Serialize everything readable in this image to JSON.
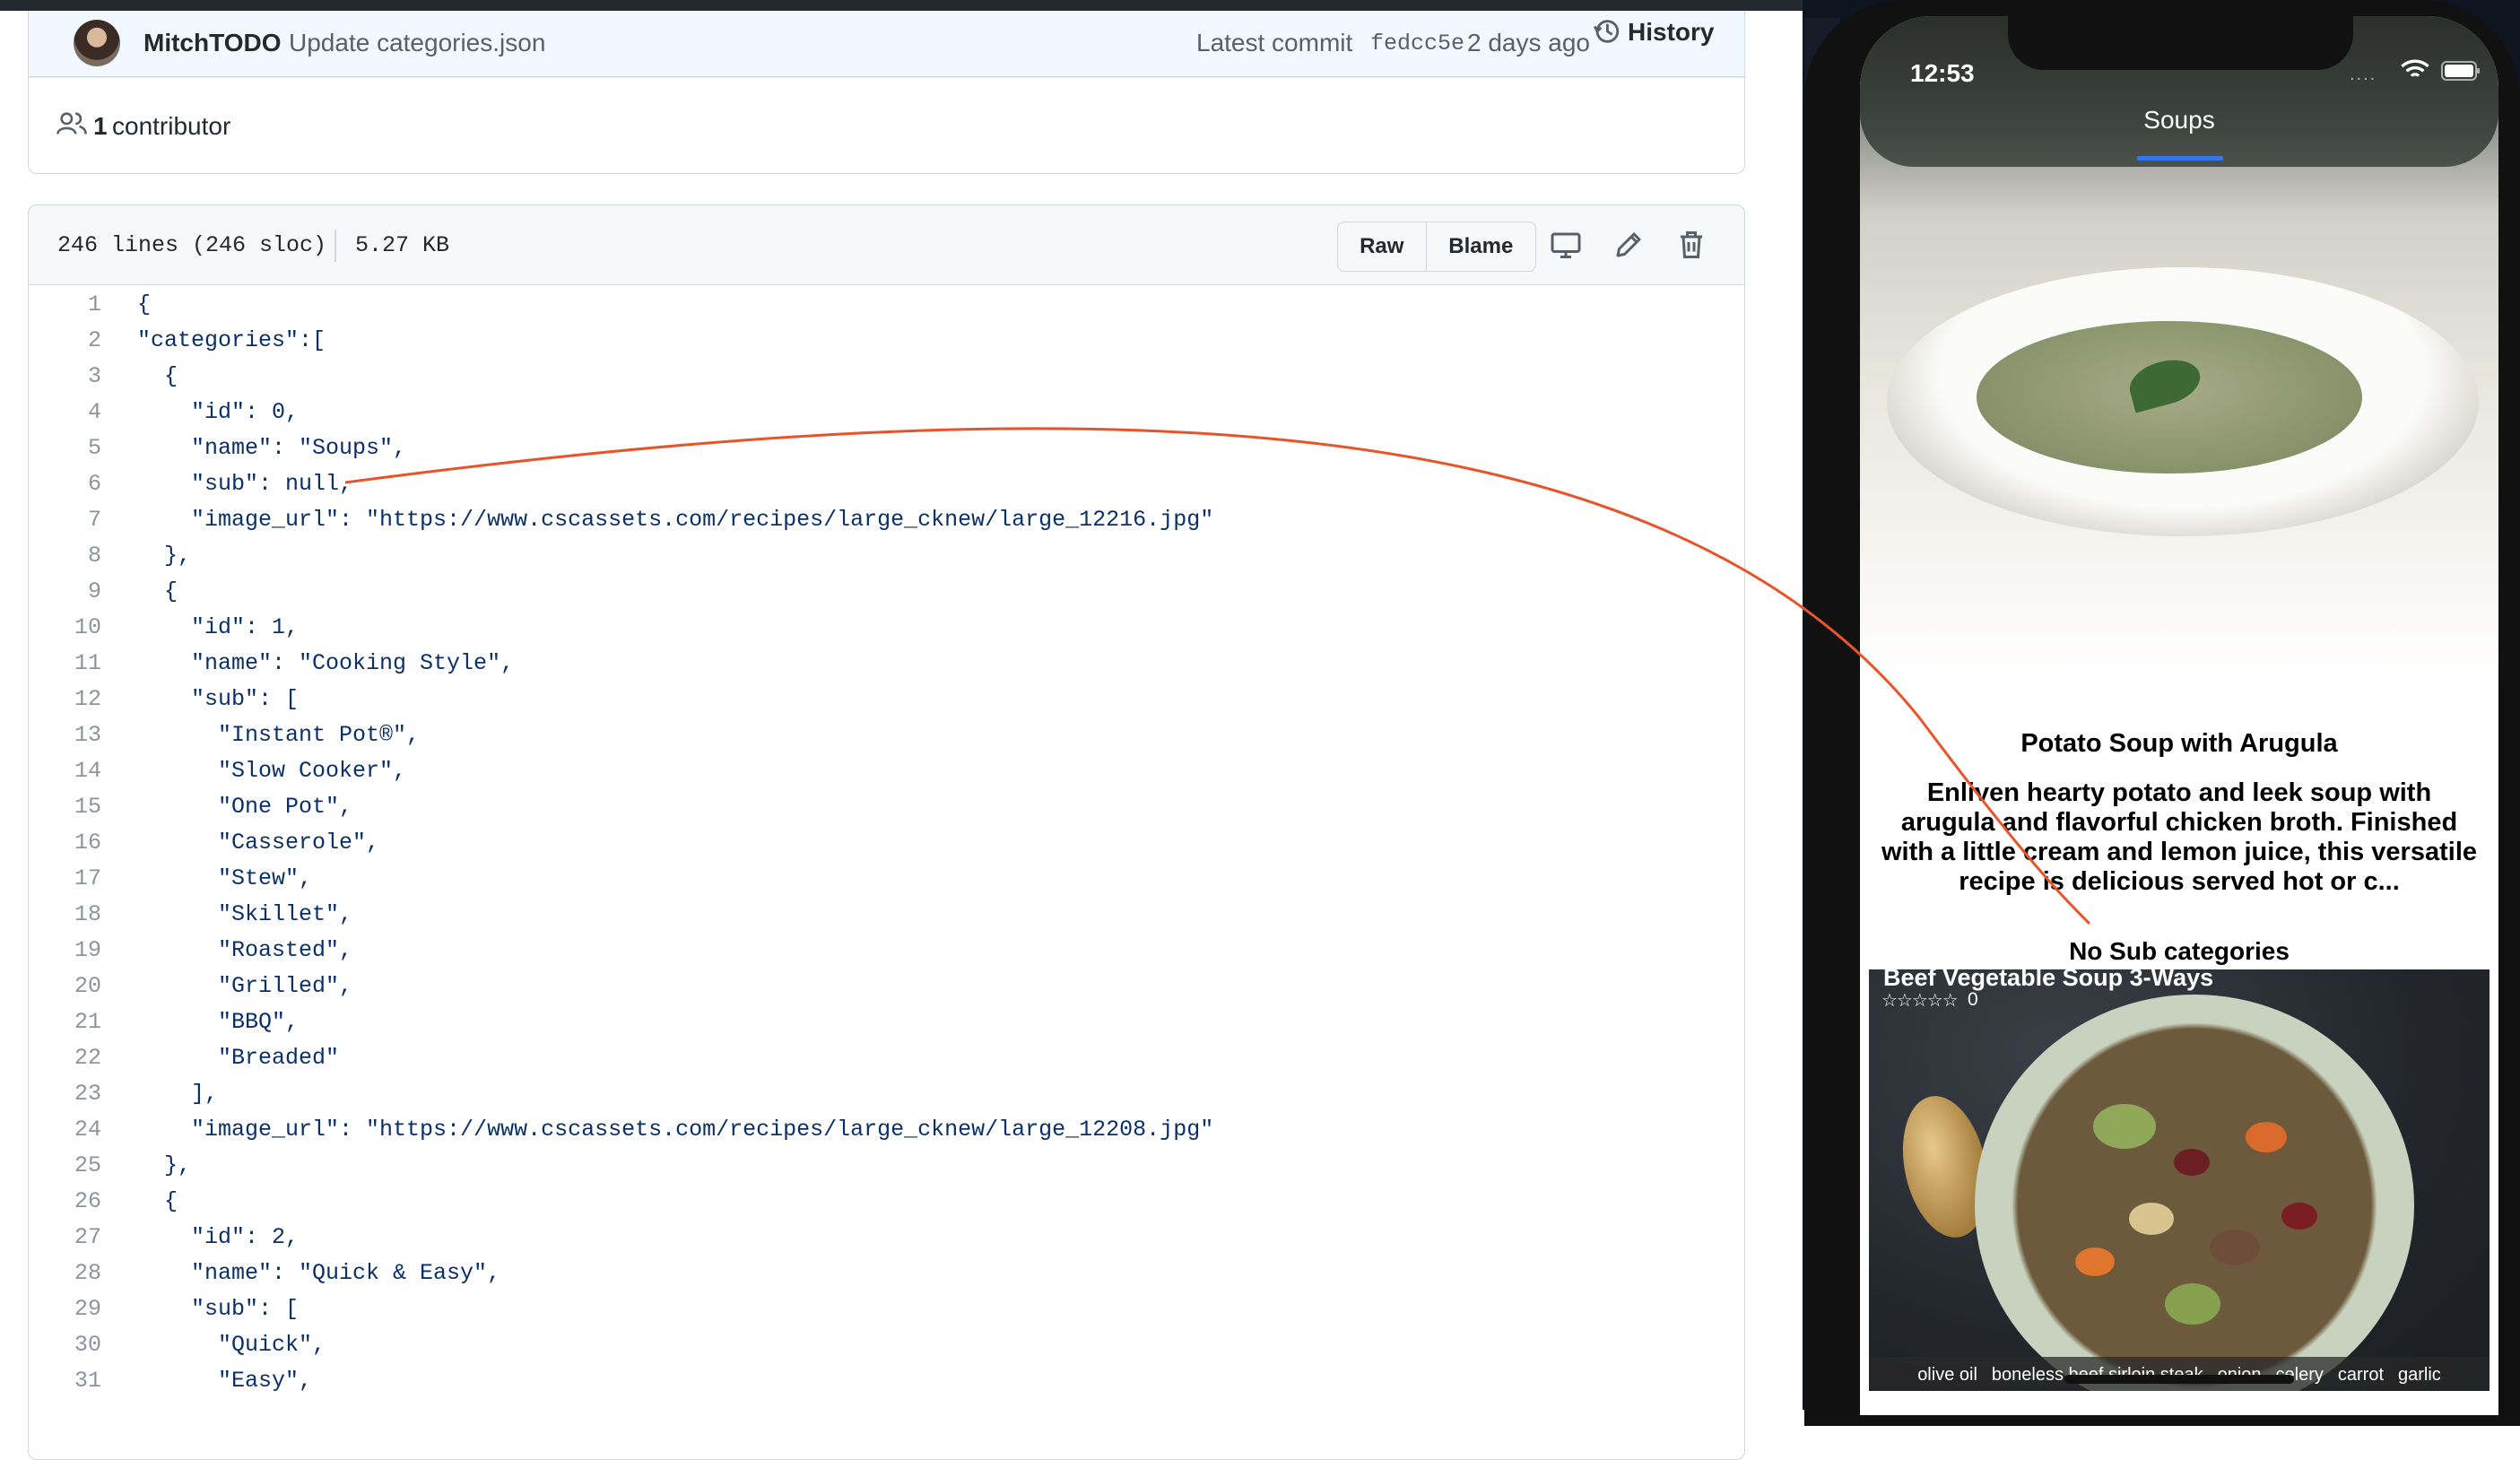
{
  "commit": {
    "author": "MitchTODO",
    "message": "Update categories.json",
    "latest_label": "Latest commit",
    "hash": "fedcc5e",
    "age": "2 days ago",
    "history_label": "History"
  },
  "contributors": {
    "count": "1",
    "label": "contributor"
  },
  "file": {
    "lines_info": "246 lines (246 sloc)",
    "size": "5.27 KB",
    "raw_label": "Raw",
    "blame_label": "Blame"
  },
  "code_lines": [
    {
      "n": "1",
      "t": "{"
    },
    {
      "n": "2",
      "t": "\"categories\":["
    },
    {
      "n": "3",
      "t": "  {"
    },
    {
      "n": "4",
      "t": "    \"id\": 0,"
    },
    {
      "n": "5",
      "t": "    \"name\": \"Soups\","
    },
    {
      "n": "6",
      "t": "    \"sub\": null,"
    },
    {
      "n": "7",
      "t": "    \"image_url\": \"https://www.cscassets.com/recipes/large_cknew/large_12216.jpg\""
    },
    {
      "n": "8",
      "t": "  },"
    },
    {
      "n": "9",
      "t": "  {"
    },
    {
      "n": "10",
      "t": "    \"id\": 1,"
    },
    {
      "n": "11",
      "t": "    \"name\": \"Cooking Style\","
    },
    {
      "n": "12",
      "t": "    \"sub\": ["
    },
    {
      "n": "13",
      "t": "      \"Instant Pot®\","
    },
    {
      "n": "14",
      "t": "      \"Slow Cooker\","
    },
    {
      "n": "15",
      "t": "      \"One Pot\","
    },
    {
      "n": "16",
      "t": "      \"Casserole\","
    },
    {
      "n": "17",
      "t": "      \"Stew\","
    },
    {
      "n": "18",
      "t": "      \"Skillet\","
    },
    {
      "n": "19",
      "t": "      \"Roasted\","
    },
    {
      "n": "20",
      "t": "      \"Grilled\","
    },
    {
      "n": "21",
      "t": "      \"BBQ\","
    },
    {
      "n": "22",
      "t": "      \"Breaded\""
    },
    {
      "n": "23",
      "t": "    ],"
    },
    {
      "n": "24",
      "t": "    \"image_url\": \"https://www.cscassets.com/recipes/large_cknew/large_12208.jpg\""
    },
    {
      "n": "25",
      "t": "  },"
    },
    {
      "n": "26",
      "t": "  {"
    },
    {
      "n": "27",
      "t": "    \"id\": 2,"
    },
    {
      "n": "28",
      "t": "    \"name\": \"Quick & Easy\","
    },
    {
      "n": "29",
      "t": "    \"sub\": ["
    },
    {
      "n": "30",
      "t": "      \"Quick\","
    },
    {
      "n": "31",
      "t": "      \"Easy\","
    }
  ],
  "phone": {
    "time": "12:53",
    "signal": "....",
    "nav_title": "Soups",
    "recipe_title": "Potato Soup with Arugula",
    "recipe_description": "Enliven hearty potato and leek soup with arugula and flavorful chicken broth. Finished with a little cream and lemon juice, this versatile recipe is delicious served hot or c...",
    "no_sub_label": "No Sub categories",
    "card_title": "Beef Vegetable Soup 3-Ways",
    "card_stars": "☆☆☆☆☆",
    "card_rating": "0",
    "ingredients": [
      "olive oil",
      "boneless beef sirloin steak",
      "onion",
      "celery",
      "carrot",
      "garlic"
    ]
  },
  "colors": {
    "commit_bg": "#f1f8ff",
    "code_string": "#0a3069",
    "code_number": "#0550ae",
    "nav_underline": "#2f77f0",
    "annotation_line": "#e8542a"
  }
}
